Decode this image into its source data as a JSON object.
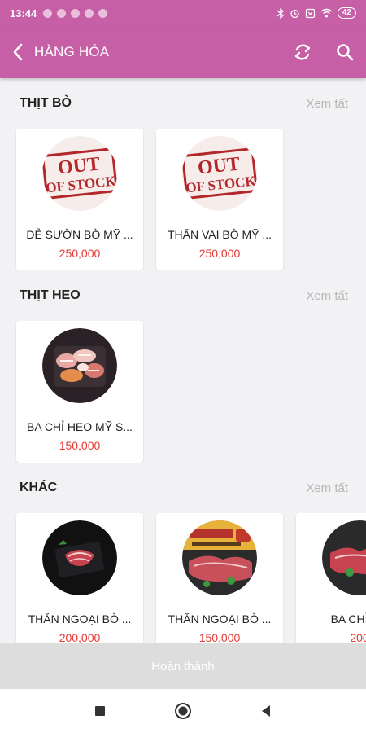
{
  "status_bar": {
    "time": "13:44",
    "battery": "42"
  },
  "app_bar": {
    "title": "HÀNG HÓA"
  },
  "sections": [
    {
      "title": "THỊT BÒ",
      "more_label": "Xem tất",
      "items": [
        {
          "name": "DẺ SƯỜN BÒ MỸ ...",
          "price": "250,000",
          "image": "out-of-stock"
        },
        {
          "name": "THĂN VAI BÒ MỸ ...",
          "price": "250,000",
          "image": "out-of-stock"
        }
      ]
    },
    {
      "title": "THỊT HEO",
      "more_label": "Xem tất",
      "items": [
        {
          "name": "BA CHỈ HEO MỸ S...",
          "price": "150,000",
          "image": "meat-platter"
        }
      ]
    },
    {
      "title": "KHÁC",
      "more_label": "Xem tất",
      "items": [
        {
          "name": "THĂN NGOẠI BÒ ...",
          "price": "200,000",
          "image": "steak-dark-plate"
        },
        {
          "name": "THĂN NGOẠI BÒ ...",
          "price": "150,000",
          "image": "meat-poster"
        },
        {
          "name": "BA CHỈ B...",
          "price": "200",
          "image": "meat-tray"
        }
      ]
    }
  ],
  "out_of_stock_stamp": {
    "line1": "OUT",
    "line2": "OF STOCK"
  },
  "footer": {
    "done_label": "Hoàn thành"
  },
  "colors": {
    "primary": "#c75fa7",
    "price": "#e53935",
    "muted": "#b6b6b6",
    "stamp": "#b3262a"
  }
}
